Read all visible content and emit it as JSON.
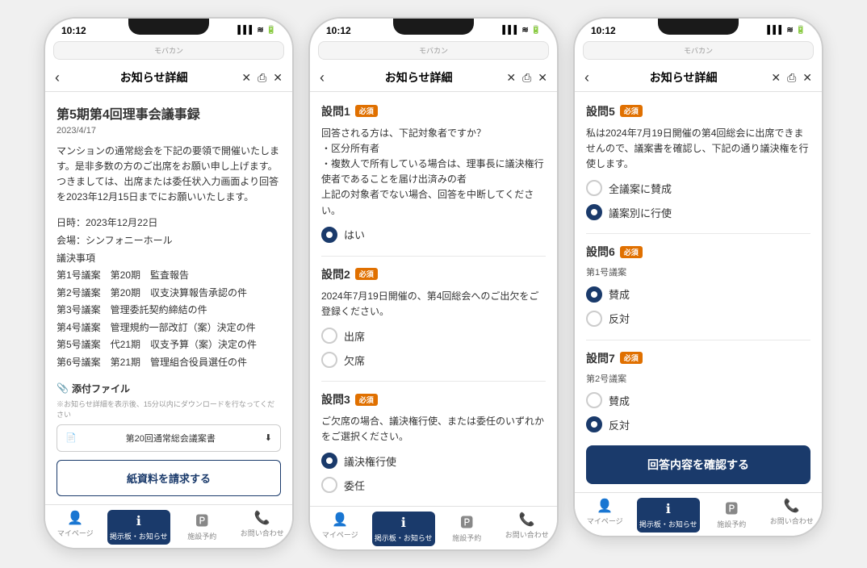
{
  "colors": {
    "primary": "#1a3a6b",
    "required": "#e07000",
    "border": "#cccccc",
    "text_secondary": "#666666"
  },
  "phone1": {
    "status_time": "10:12",
    "app_name": "モバカン",
    "browser_url": "www.*****.co.jp",
    "nav_title": "お知らせ詳細",
    "content_title": "第5期第4回理事会議事録",
    "content_date": "2023/4/17",
    "body_paragraph1": "マンションの通常総会を下記の要領で開催いたします。是非多数の方のご出席をお願い申し上げます。つきましては、出席または委任状入力画面より回答を2023年12月15日までにお願いいたします。",
    "info_lines": [
      "日時：2023年12月22日",
      "会場：シンフォニーホール",
      "議決事項",
      "第1号議案　第20期　監査報告",
      "第2号議案　第20期　収支決算報告承認の件",
      "第3号議案　管理委託契約締結の件",
      "第4号議案　管理規約一部改訂（案）決定の件",
      "第5号議案　代21期　収支予算（案）決定の件",
      "第6号議案　第21期　管理組合役員選任の件"
    ],
    "attachment_label": "添付ファイル",
    "attachment_clip": "📎",
    "attachment_note": "※お知らせ詳細を表示後、15分以内にダウンロードを行なってください",
    "attachment_filename": "第20回通常総会議案書",
    "paper_request_btn": "紙資料を請求する",
    "bottom_nav": [
      {
        "label": "マイページ",
        "icon": "👤",
        "active": false
      },
      {
        "label": "掲示板・お知らせ",
        "icon": "ℹ",
        "active": true
      },
      {
        "label": "施設予約",
        "icon": "🅿",
        "active": false
      },
      {
        "label": "お問い合わせ",
        "icon": "📞",
        "active": false
      }
    ]
  },
  "phone2": {
    "status_time": "10:12",
    "app_name": "モバカン",
    "browser_url": "www.*****.co.jp",
    "nav_title": "お知らせ詳細",
    "questions": [
      {
        "number": "設問1",
        "required": true,
        "text": "回答される方は、下記対象者ですか？\n・区分所有者\n・複数人で所有している場合は、理事長に議決権行使者であることを届け出済みの者\n上記の対象者でない場合、回答を中断してください。",
        "options": [
          {
            "label": "はい",
            "checked": true
          }
        ]
      },
      {
        "number": "設問2",
        "required": true,
        "text": "2024年7月19日開催の、第4回総会へのご出欠をご登録ください。",
        "options": [
          {
            "label": "出席",
            "checked": false
          },
          {
            "label": "欠席",
            "checked": false
          }
        ]
      },
      {
        "number": "設問3",
        "required": true,
        "text": "ご欠席の場合、議決権行使、または委任のいずれかをご選択ください。",
        "options": [
          {
            "label": "議決権行使",
            "checked": true
          },
          {
            "label": "委任",
            "checked": false
          }
        ]
      }
    ],
    "bottom_nav": [
      {
        "label": "マイページ",
        "icon": "👤",
        "active": false
      },
      {
        "label": "掲示板・お知らせ",
        "icon": "ℹ",
        "active": true
      },
      {
        "label": "施設予約",
        "icon": "🅿",
        "active": false
      },
      {
        "label": "お問い合わせ",
        "icon": "📞",
        "active": false
      }
    ]
  },
  "phone3": {
    "status_time": "10:12",
    "app_name": "モバカン",
    "browser_url": "www.*****.co.jp",
    "nav_title": "お知らせ詳細",
    "questions": [
      {
        "number": "設問5",
        "required": true,
        "text": "私は2024年7月19日開催の第4回総会に出席できませんので、議案書を確認し、下記の通り議決権を行使します。",
        "options": [
          {
            "label": "全議案に賛成",
            "checked": false
          },
          {
            "label": "議案別に行使",
            "checked": true
          }
        ]
      },
      {
        "number": "設問6",
        "required": true,
        "sub_label": "第1号議案",
        "text": "",
        "options": [
          {
            "label": "賛成",
            "checked": true
          },
          {
            "label": "反対",
            "checked": false
          }
        ]
      },
      {
        "number": "設問7",
        "required": true,
        "sub_label": "第2号議案",
        "text": "",
        "options": [
          {
            "label": "賛成",
            "checked": false
          },
          {
            "label": "反対",
            "checked": true
          }
        ]
      }
    ],
    "confirm_btn": "回答内容を確認する",
    "bottom_nav": [
      {
        "label": "マイページ",
        "icon": "👤",
        "active": false
      },
      {
        "label": "掲示板・お知らせ",
        "icon": "ℹ",
        "active": true
      },
      {
        "label": "施設予約",
        "icon": "🅿",
        "active": false
      },
      {
        "label": "お問い合わせ",
        "icon": "📞",
        "active": false
      }
    ]
  }
}
